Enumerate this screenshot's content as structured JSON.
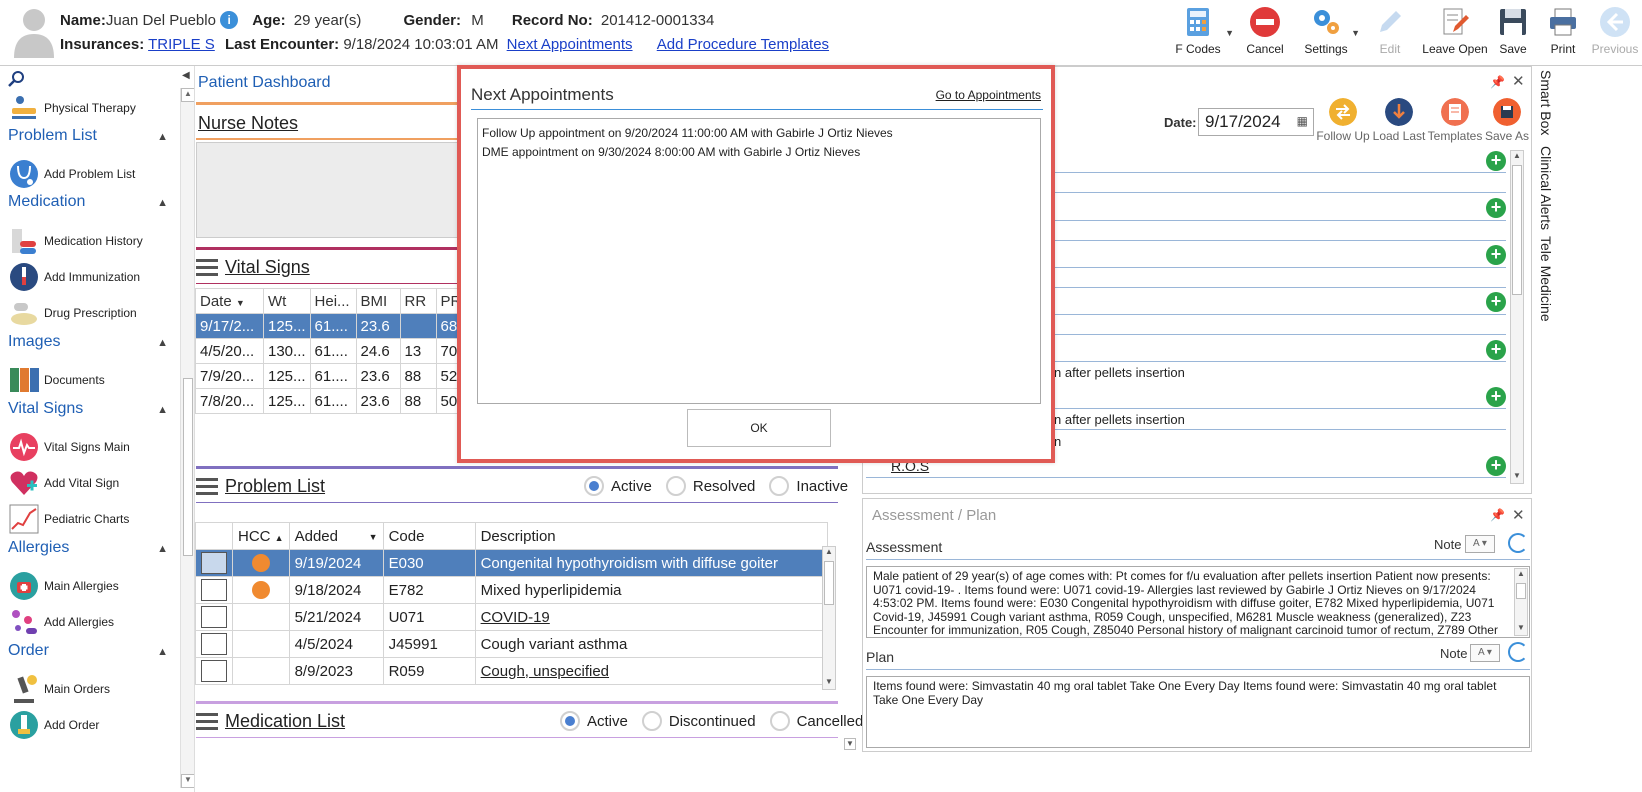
{
  "patient": {
    "name_label": "Name:",
    "name": "Juan Del Pueblo",
    "age_label": "Age:",
    "age": "29 year(s)",
    "gender_label": "Gender:",
    "gender": "M",
    "record_label": "Record No:",
    "record": "201412-0001334",
    "insurances_label": "Insurances:",
    "insurance": "TRIPLE S",
    "last_encounter_label": "Last Encounter:",
    "last_encounter": "9/18/2024 10:03:01 AM",
    "next_appointments_link": "Next Appointments",
    "add_procedure_link": "Add Procedure Templates"
  },
  "toolbar": {
    "fcodes": "F Codes",
    "cancel": "Cancel",
    "settings": "Settings",
    "edit": "Edit",
    "leave_open": "Leave Open",
    "save": "Save",
    "print": "Print",
    "previous": "Previous"
  },
  "sidebar": {
    "physical_therapy": "Physical Therapy",
    "sec_problem_list": "Problem List",
    "add_problem_list": "Add Problem List",
    "sec_medication": "Medication",
    "medication_history": "Medication History",
    "add_immunization": "Add Immunization",
    "drug_prescription": "Drug Prescription",
    "sec_images": "Images",
    "documents": "Documents",
    "sec_vital_signs": "Vital Signs",
    "vital_signs_main": "Vital Signs Main",
    "add_vital_sign": "Add Vital Sign",
    "pediatric_charts": "Pediatric Charts",
    "sec_allergies": "Allergies",
    "main_allergies": "Main Allergies",
    "add_allergies": "Add Allergies",
    "sec_order": "Order",
    "main_orders": "Main Orders",
    "add_order": "Add Order"
  },
  "dashboard": {
    "title": "Patient Dashboard",
    "nurse_notes": "Nurse Notes",
    "vital_signs": "Vital Signs",
    "problem_list": "Problem List",
    "medication_list": "Medication List"
  },
  "vitals_table": {
    "headers": [
      "Date",
      "Wt",
      "Hei...",
      "BMI",
      "RR",
      "PR"
    ],
    "rows": [
      [
        "9/17/2...",
        "125...",
        "61....",
        "23.6",
        "",
        "68"
      ],
      [
        "4/5/20...",
        "130...",
        "61....",
        "24.6",
        "13",
        "70"
      ],
      [
        "7/9/20...",
        "125...",
        "61....",
        "23.6",
        "88",
        "52"
      ],
      [
        "7/8/20...",
        "125...",
        "61....",
        "23.6",
        "88",
        "50"
      ]
    ]
  },
  "problem_filters": {
    "active": "Active",
    "resolved": "Resolved",
    "inactive": "Inactive"
  },
  "medication_filters": {
    "active": "Active",
    "discontinued": "Discontinued",
    "cancelled": "Cancelled"
  },
  "problem_table": {
    "headers": [
      "HCC",
      "Added",
      "Code",
      "Description"
    ],
    "rows": [
      {
        "hcc": true,
        "added": "9/19/2024",
        "code": "E030",
        "desc": "Congenital hypothyroidism with diffuse goiter"
      },
      {
        "hcc": true,
        "added": "9/18/2024",
        "code": "E782",
        "desc": "Mixed hyperlipidemia"
      },
      {
        "hcc": false,
        "added": "5/21/2024",
        "code": "U071",
        "desc": "COVID-19"
      },
      {
        "hcc": false,
        "added": "4/5/2024",
        "code": "J45991",
        "desc": "Cough variant asthma"
      },
      {
        "hcc": false,
        "added": "8/9/2023",
        "code": "R059",
        "desc": "Cough, unspecified"
      }
    ]
  },
  "right_panel": {
    "date_label": "Date:",
    "date_value": "9/17/2024",
    "follow_up": "Follow Up",
    "load_last": "Load Last",
    "templates": "Templates",
    "save_as": "Save As",
    "frag1": "n after pellets insertion",
    "frag2": "n after pellets insertion",
    "frag3": "n",
    "ros": "R.O.S"
  },
  "side_tabs": {
    "smart_box": "Smart Box",
    "clinical_alerts": "Clinical Alerts",
    "tele_medicine": "Tele Medicine"
  },
  "assessment_plan": {
    "title": "Assessment / Plan",
    "assessment_label": "Assessment",
    "plan_label": "Plan",
    "note_label": "Note",
    "assessment_text": "Male patient of 29 year(s) of age comes with:  Pt comes for f/u evaluation after pellets insertion  Patient now presents: U071 covid-19- . Items found were:  U071 covid-19-    Allergies last reviewed by Gabirle J Ortiz Nieves on 9/17/2024 4:53:02 PM.     Items found were:  E030 Congenital hypothyroidism with diffuse goiter, E782 Mixed hyperlipidemia, U071 Covid-19, J45991 Cough variant asthma, R059 Cough, unspecified, M6281 Muscle weakness (generalized), Z23 Encounter for immunization, R05 Cough, Z85040 Personal history of malignant carcinoid tumor of rectum, Z789 Other",
    "plan_text": "  Items found were:  Simvastatin 40 mg oral tablet Take One Every Day   Items found were:  Simvastatin 40 mg oral tablet Take One Every Day"
  },
  "modal": {
    "title": "Next Appointments",
    "go_link": "Go to Appointments",
    "appointments": [
      "Follow Up appointment on 9/20/2024 11:00:00 AM with Gabirle J Ortiz Nieves",
      "DME appointment on 9/30/2024 8:00:00 AM with Gabirle J Ortiz Nieves"
    ],
    "ok": "OK"
  }
}
